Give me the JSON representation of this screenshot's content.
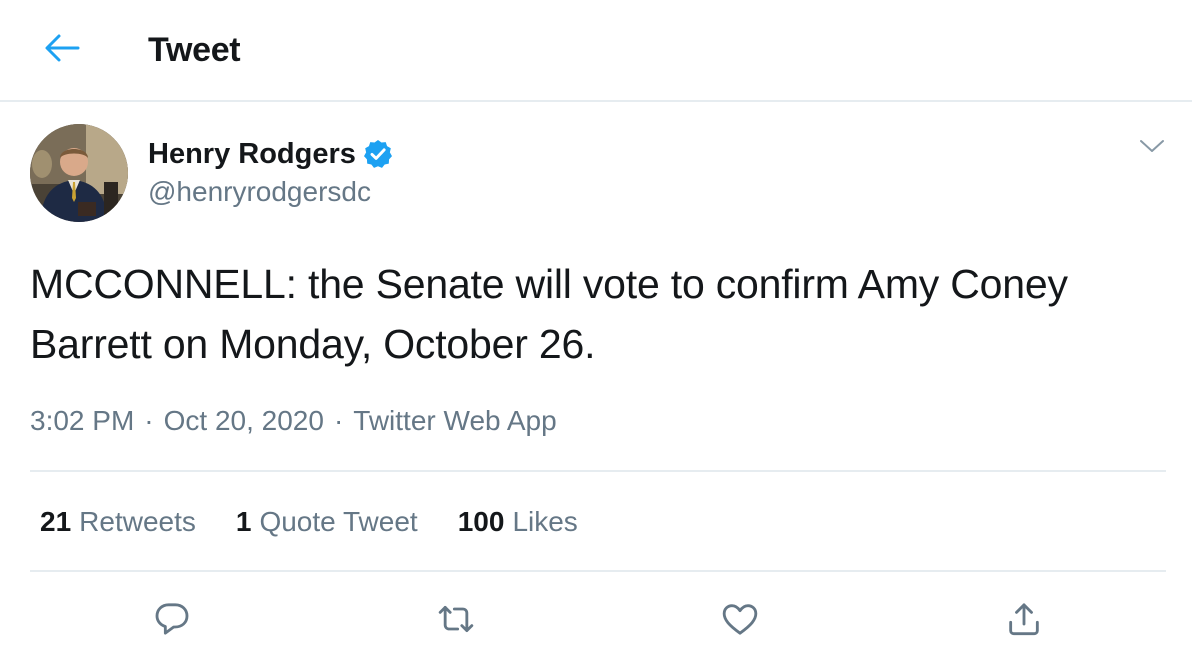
{
  "header": {
    "title": "Tweet",
    "back_icon": "arrow-left-icon",
    "accent_color": "#1da1f2"
  },
  "author": {
    "name": "Henry Rodgers",
    "handle": "@henryrodgersdc",
    "verified": true,
    "verified_icon": "verified-badge-icon"
  },
  "tweet": {
    "text": "MCCONNELL: the Senate will vote to confirm Amy Coney Barrett on Monday, October 26.",
    "time": "3:02 PM",
    "date": "Oct 20, 2020",
    "source": "Twitter Web App",
    "separator": "·"
  },
  "stats": {
    "retweets": {
      "count": "21",
      "label": "Retweets"
    },
    "quotes": {
      "count": "1",
      "label": "Quote Tweet"
    },
    "likes": {
      "count": "100",
      "label": "Likes"
    }
  },
  "actions": [
    {
      "name": "reply",
      "icon": "reply-icon"
    },
    {
      "name": "retweet",
      "icon": "retweet-icon"
    },
    {
      "name": "like",
      "icon": "heart-icon"
    },
    {
      "name": "share",
      "icon": "share-icon"
    }
  ],
  "colors": {
    "text_primary": "#14171a",
    "text_secondary": "#657786",
    "divider": "#e6ecf0",
    "verified_badge": "#1da1f2"
  }
}
